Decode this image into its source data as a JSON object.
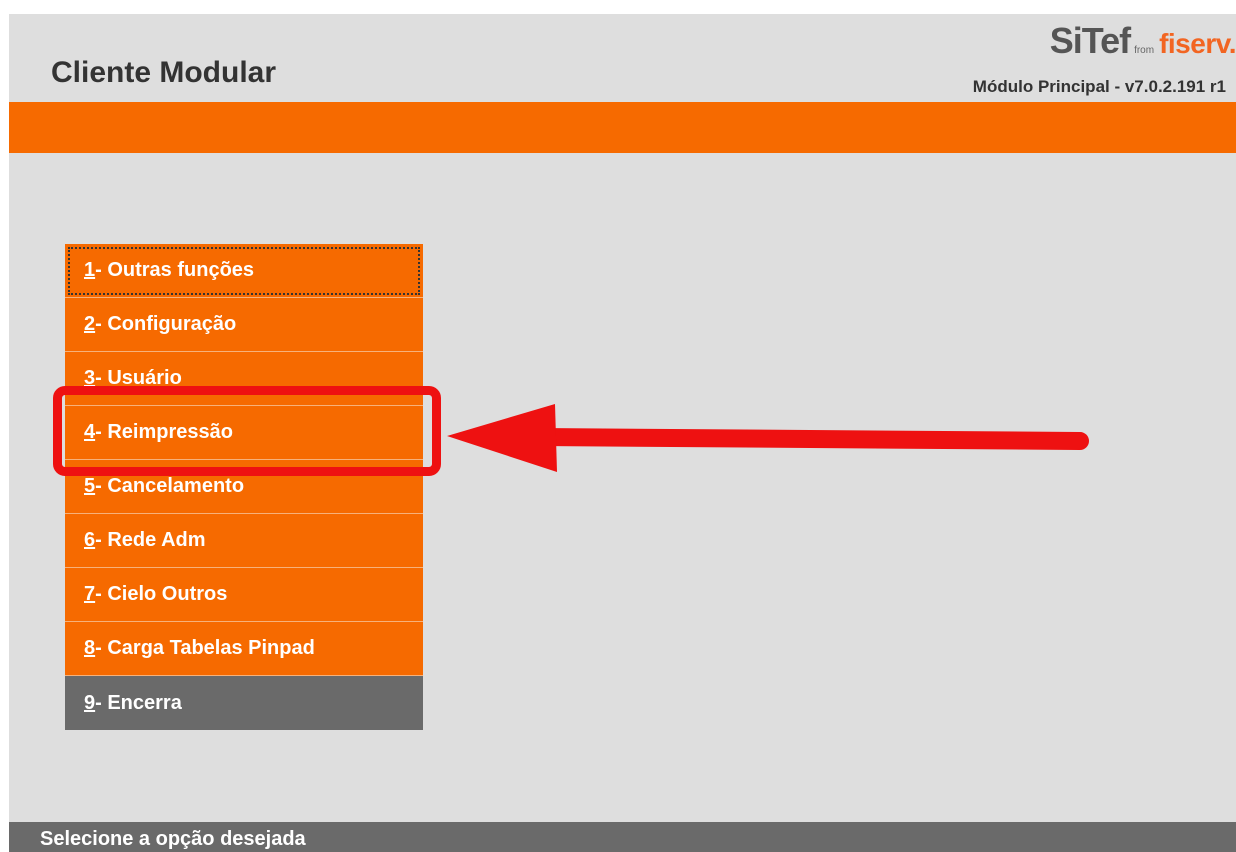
{
  "app": {
    "title": "Cliente Modular"
  },
  "logo": {
    "brand": "SiTef",
    "from": "from",
    "partner": "fiserv."
  },
  "module_version": "Módulo Principal - v7.0.2.191 r1",
  "menu": {
    "items": [
      {
        "num": "1",
        "label": " - Outras funções"
      },
      {
        "num": "2",
        "label": " - Configuração"
      },
      {
        "num": "3",
        "label": " - Usuário"
      },
      {
        "num": "4",
        "label": " - Reimpressão"
      },
      {
        "num": "5",
        "label": " - Cancelamento"
      },
      {
        "num": "6",
        "label": " - Rede Adm"
      },
      {
        "num": "7",
        "label": " - Cielo Outros"
      },
      {
        "num": "8",
        "label": " - Carga Tabelas Pinpad"
      },
      {
        "num": "9",
        "label": " - Encerra"
      }
    ]
  },
  "status": {
    "text": "Selecione a opção desejada"
  },
  "colors": {
    "accent_orange": "#f66a00",
    "exit_gray": "#6a6a6a",
    "background": "#dedede",
    "annotation_red": "#ee1111"
  },
  "annotation": {
    "highlighted_item": "4",
    "arrow_icon": "red-arrow-left"
  }
}
